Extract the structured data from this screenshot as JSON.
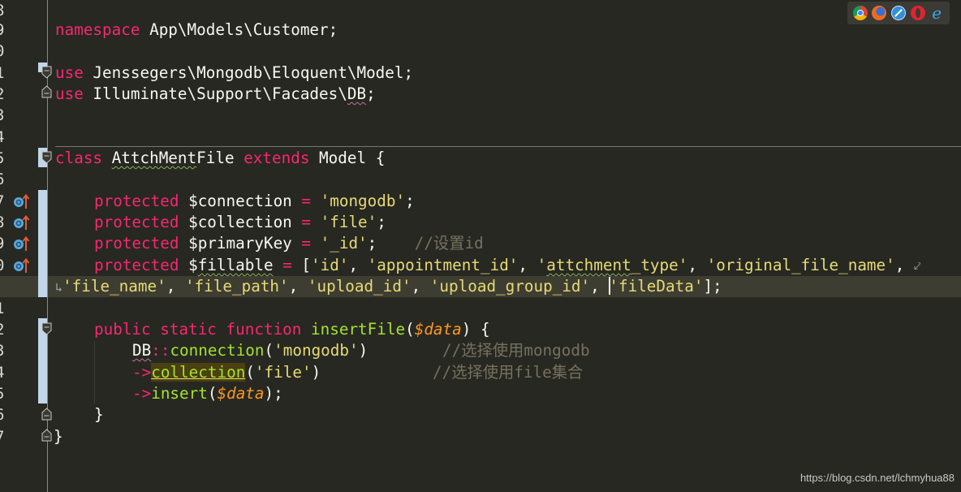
{
  "editor": {
    "line_numbers": [
      "8",
      "9",
      "0",
      "1",
      "2",
      "3",
      "4",
      "5",
      "6",
      "7",
      "8",
      "9",
      "0",
      "",
      "1",
      "2",
      "3",
      "4",
      "5",
      "6",
      "7"
    ],
    "lines": {
      "l9": [
        {
          "t": "namespace",
          "c": "kw"
        },
        {
          "t": " App\\Models\\Customer;",
          "c": "plain"
        }
      ],
      "l11": [
        {
          "t": "use",
          "c": "kw"
        },
        {
          "t": " Jenssegers\\Mongodb\\Eloquent\\Model;",
          "c": "plain"
        }
      ],
      "l12a": {
        "kw": "use",
        "text": " Illuminate\\Support\\Facades\\",
        "db": "DB",
        "end": ";"
      },
      "l15": {
        "kw": "class",
        "name": "AttchMent",
        "name2": "File",
        "ext": "extends",
        "rest": " Model {"
      },
      "l17": {
        "kw": "protected",
        "var": " $connection ",
        "eq": "=",
        "str": " 'mongodb'",
        "end": ";"
      },
      "l18": {
        "kw": "protected",
        "var": " $collection ",
        "eq": "=",
        "str": " 'file'",
        "end": ";"
      },
      "l19": {
        "kw": "protected",
        "var": " $primaryKey ",
        "eq": "=",
        "str": " '_id'",
        "end": ";",
        "comment": "    //设置id"
      },
      "l20": {
        "kw": "protected",
        "var1": " $",
        "var2": "fillable",
        "var3": " ",
        "eq": "=",
        "open": " [",
        "s1": "'id'",
        "s2": "'appointment_id'",
        "s3a": "'",
        "s3b": "attchment",
        "s3c": "_type'",
        "s4": "'original_file_name'",
        "sep": ", "
      },
      "l20b": {
        "s5": "'file_name'",
        "s6": "'file_path'",
        "s7": "'upload_id'",
        "s8": "'upload_group_id'",
        "s9": "'fileData'",
        "close": "];",
        "sep": ", "
      },
      "l22": {
        "kw1": "public",
        "kw2": "static",
        "kw3": "function",
        "fn": "insertFile",
        "open": "(",
        "param": "$data",
        "close": ") {"
      },
      "l23": {
        "db": "DB",
        "op": "::",
        "fn": "connection",
        "open": "(",
        "str": "'mongodb'",
        "close": ")",
        "comment": "//选择使用mongodb"
      },
      "l24": {
        "op": "->",
        "fn": "collection",
        "open": "(",
        "str": "'file'",
        "close": ")",
        "comment": "//选择使用file集合"
      },
      "l25": {
        "op": "->",
        "fn": "insert",
        "open": "(",
        "param": "$data",
        "close": ");"
      },
      "l26": "}",
      "l27": "}"
    }
  },
  "browser_icons": [
    "chrome-icon",
    "firefox-icon",
    "safari-icon",
    "opera-icon",
    "ie-icon"
  ],
  "watermark": "https://blog.csdn.net/lchmyhua88",
  "colors": {
    "background": "#272822",
    "keyword": "#f92672",
    "string": "#e6db74",
    "function": "#a6e22e",
    "parameter": "#fd971f",
    "comment": "#75715e"
  }
}
